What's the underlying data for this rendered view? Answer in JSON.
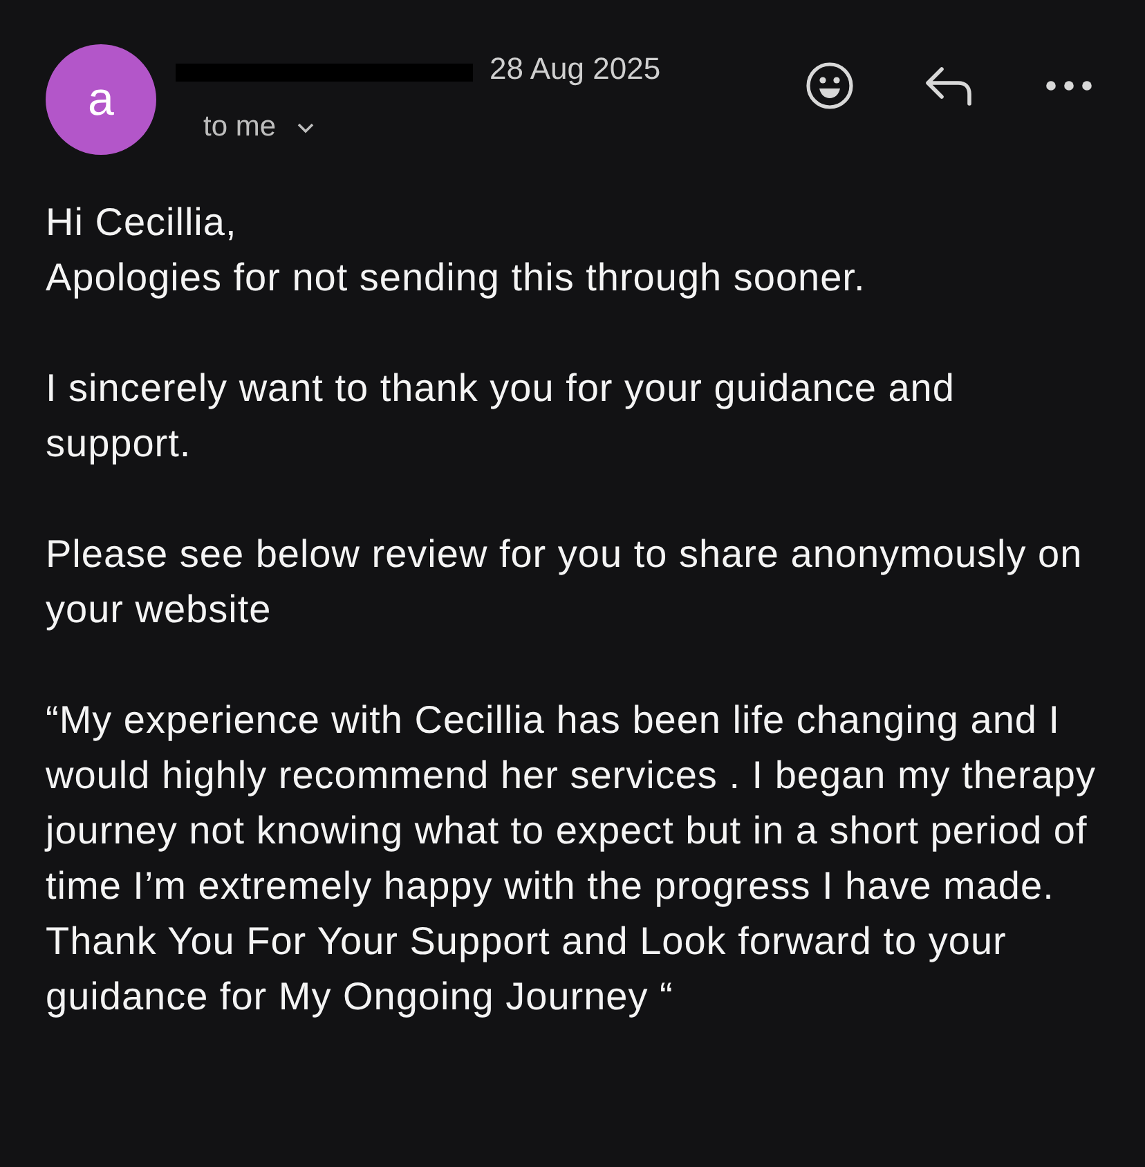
{
  "sender": {
    "avatar_letter": "a"
  },
  "date": "28 Aug 2025",
  "recipient": "to me",
  "body": [
    [
      "Hi Cecillia,",
      "Apologies for not sending this through sooner."
    ],
    [
      "I sincerely want to thank you for your guidance and support."
    ],
    [
      "Please see below review for you to share anonymously on your website"
    ],
    [
      "“My experience with Cecillia has been life changing and I would highly recommend her services . I began my therapy journey not knowing what to expect but in a short period of time I’m extremely happy with the progress I have made.",
      "Thank You For Your Support and Look forward to your guidance for My Ongoing Journey “"
    ]
  ]
}
